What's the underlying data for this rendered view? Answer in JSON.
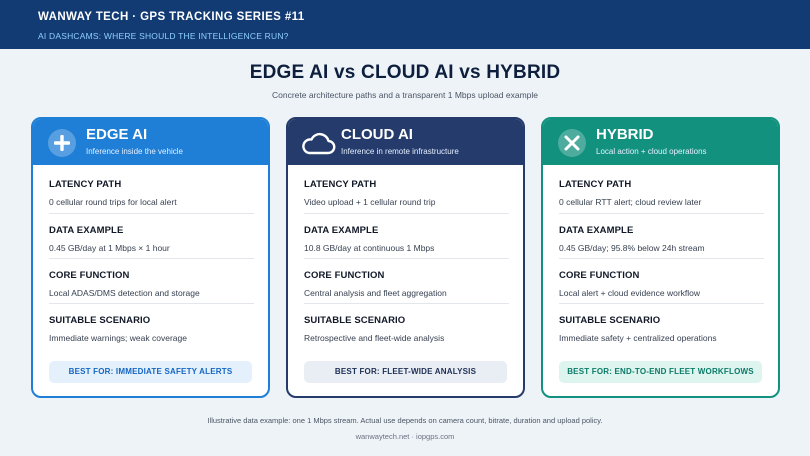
{
  "header": {
    "series_title": "WANWAY TECH · GPS TRACKING SERIES #11",
    "topic": "AI DASHCAMS: WHERE SHOULD THE INTELLIGENCE RUN?"
  },
  "main": {
    "title": "EDGE AI vs CLOUD AI vs HYBRID",
    "subtitle": "Concrete architecture paths and a transparent 1 Mbps upload example"
  },
  "cards": [
    {
      "name": "EDGE AI",
      "tagline": "Inference inside the vehicle",
      "icon": "plus-circle-icon",
      "color": "#1f7fd6",
      "sections": [
        {
          "label": "LATENCY PATH",
          "value": "0 cellular round trips for local alert"
        },
        {
          "label": "DATA EXAMPLE",
          "value": "0.45 GB/day at 1 Mbps × 1 hour"
        },
        {
          "label": "CORE FUNCTION",
          "value": "Local ADAS/DMS detection and storage"
        },
        {
          "label": "SUITABLE SCENARIO",
          "value": "Immediate warnings; weak coverage"
        }
      ],
      "best_for": "BEST FOR: IMMEDIATE SAFETY ALERTS"
    },
    {
      "name": "CLOUD AI",
      "tagline": "Inference in remote infrastructure",
      "icon": "cloud-icon",
      "color": "#243b6b",
      "sections": [
        {
          "label": "LATENCY PATH",
          "value": "Video upload + 1 cellular round trip"
        },
        {
          "label": "DATA EXAMPLE",
          "value": "10.8 GB/day at continuous 1 Mbps"
        },
        {
          "label": "CORE FUNCTION",
          "value": "Central analysis and fleet aggregation"
        },
        {
          "label": "SUITABLE SCENARIO",
          "value": "Retrospective and fleet-wide analysis"
        }
      ],
      "best_for": "BEST FOR: FLEET-WIDE ANALYSIS"
    },
    {
      "name": "HYBRID",
      "tagline": "Local action + cloud operations",
      "icon": "cross-circle-icon",
      "color": "#13917f",
      "sections": [
        {
          "label": "LATENCY PATH",
          "value": "0 cellular RTT alert; cloud review later"
        },
        {
          "label": "DATA EXAMPLE",
          "value": "0.45 GB/day; 95.8% below 24h stream"
        },
        {
          "label": "CORE FUNCTION",
          "value": "Local alert + cloud evidence workflow"
        },
        {
          "label": "SUITABLE SCENARIO",
          "value": "Immediate safety + centralized operations"
        }
      ],
      "best_for": "BEST FOR: END-TO-END FLEET WORKFLOWS"
    }
  ],
  "footnote": "Illustrative data example: one 1 Mbps stream. Actual use depends on camera count, bitrate, duration and upload policy.",
  "footer": "wanwaytech.net · iopgps.com"
}
